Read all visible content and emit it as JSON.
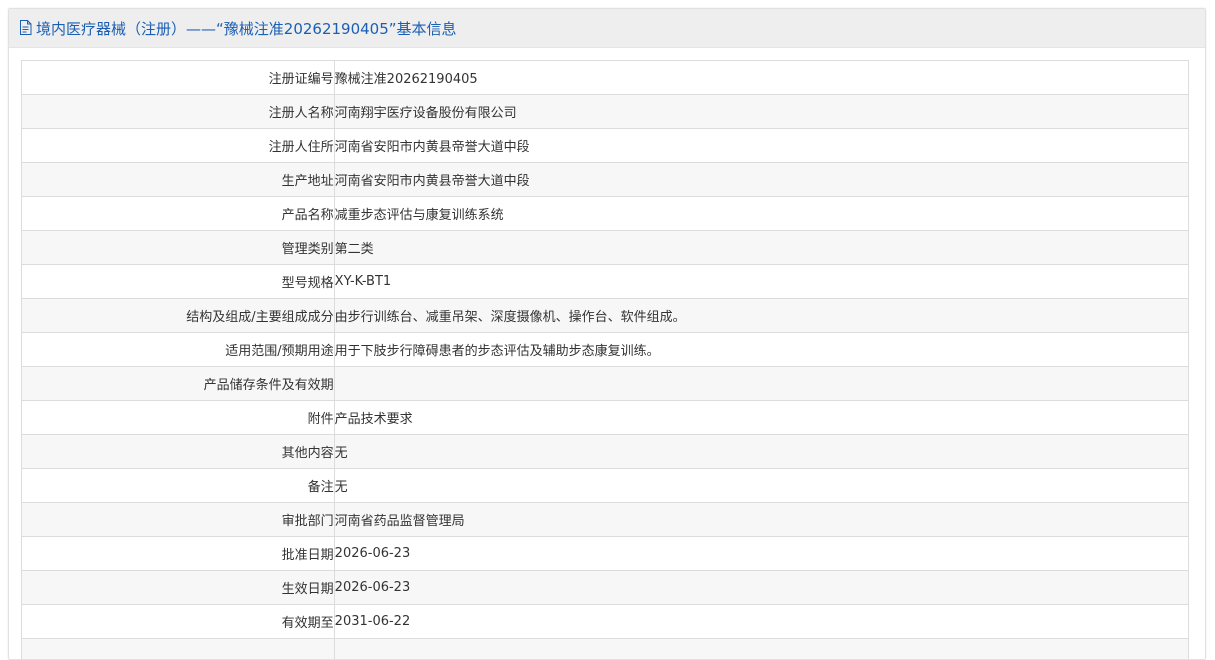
{
  "header": {
    "title": "境内医疗器械（注册）——“豫械注准20262190405”基本信息"
  },
  "rows": [
    {
      "label": "注册证编号",
      "value": "豫械注准20262190405"
    },
    {
      "label": "注册人名称",
      "value": "河南翔宇医疗设备股份有限公司"
    },
    {
      "label": "注册人住所",
      "value": "河南省安阳市内黄县帝誉大道中段"
    },
    {
      "label": "生产地址",
      "value": "河南省安阳市内黄县帝誉大道中段"
    },
    {
      "label": "产品名称",
      "value": "减重步态评估与康复训练系统"
    },
    {
      "label": "管理类别",
      "value": "第二类"
    },
    {
      "label": "型号规格",
      "value": "XY-K-BT1"
    },
    {
      "label": "结构及组成/主要组成成分",
      "value": "由步行训练台、减重吊架、深度摄像机、操作台、软件组成。"
    },
    {
      "label": "适用范围/预期用途",
      "value": "用于下肢步行障碍患者的步态评估及辅助步态康复训练。"
    },
    {
      "label": "产品储存条件及有效期",
      "value": ""
    },
    {
      "label": "附件",
      "value": "产品技术要求"
    },
    {
      "label": "其他内容",
      "value": "无"
    },
    {
      "label": "备注",
      "value": "无"
    },
    {
      "label": "审批部门",
      "value": "河南省药品监督管理局"
    },
    {
      "label": "批准日期",
      "value": "2026-06-23"
    },
    {
      "label": "生效日期",
      "value": "2026-06-23"
    },
    {
      "label": "有效期至",
      "value": "2031-06-22"
    },
    {
      "label": "",
      "value": ""
    }
  ],
  "colors": {
    "header_text": "#1a5fb4",
    "header_bg": "#eeeeee",
    "row_alt_bg": "#f7f7f7",
    "border": "#dcdcdc"
  }
}
